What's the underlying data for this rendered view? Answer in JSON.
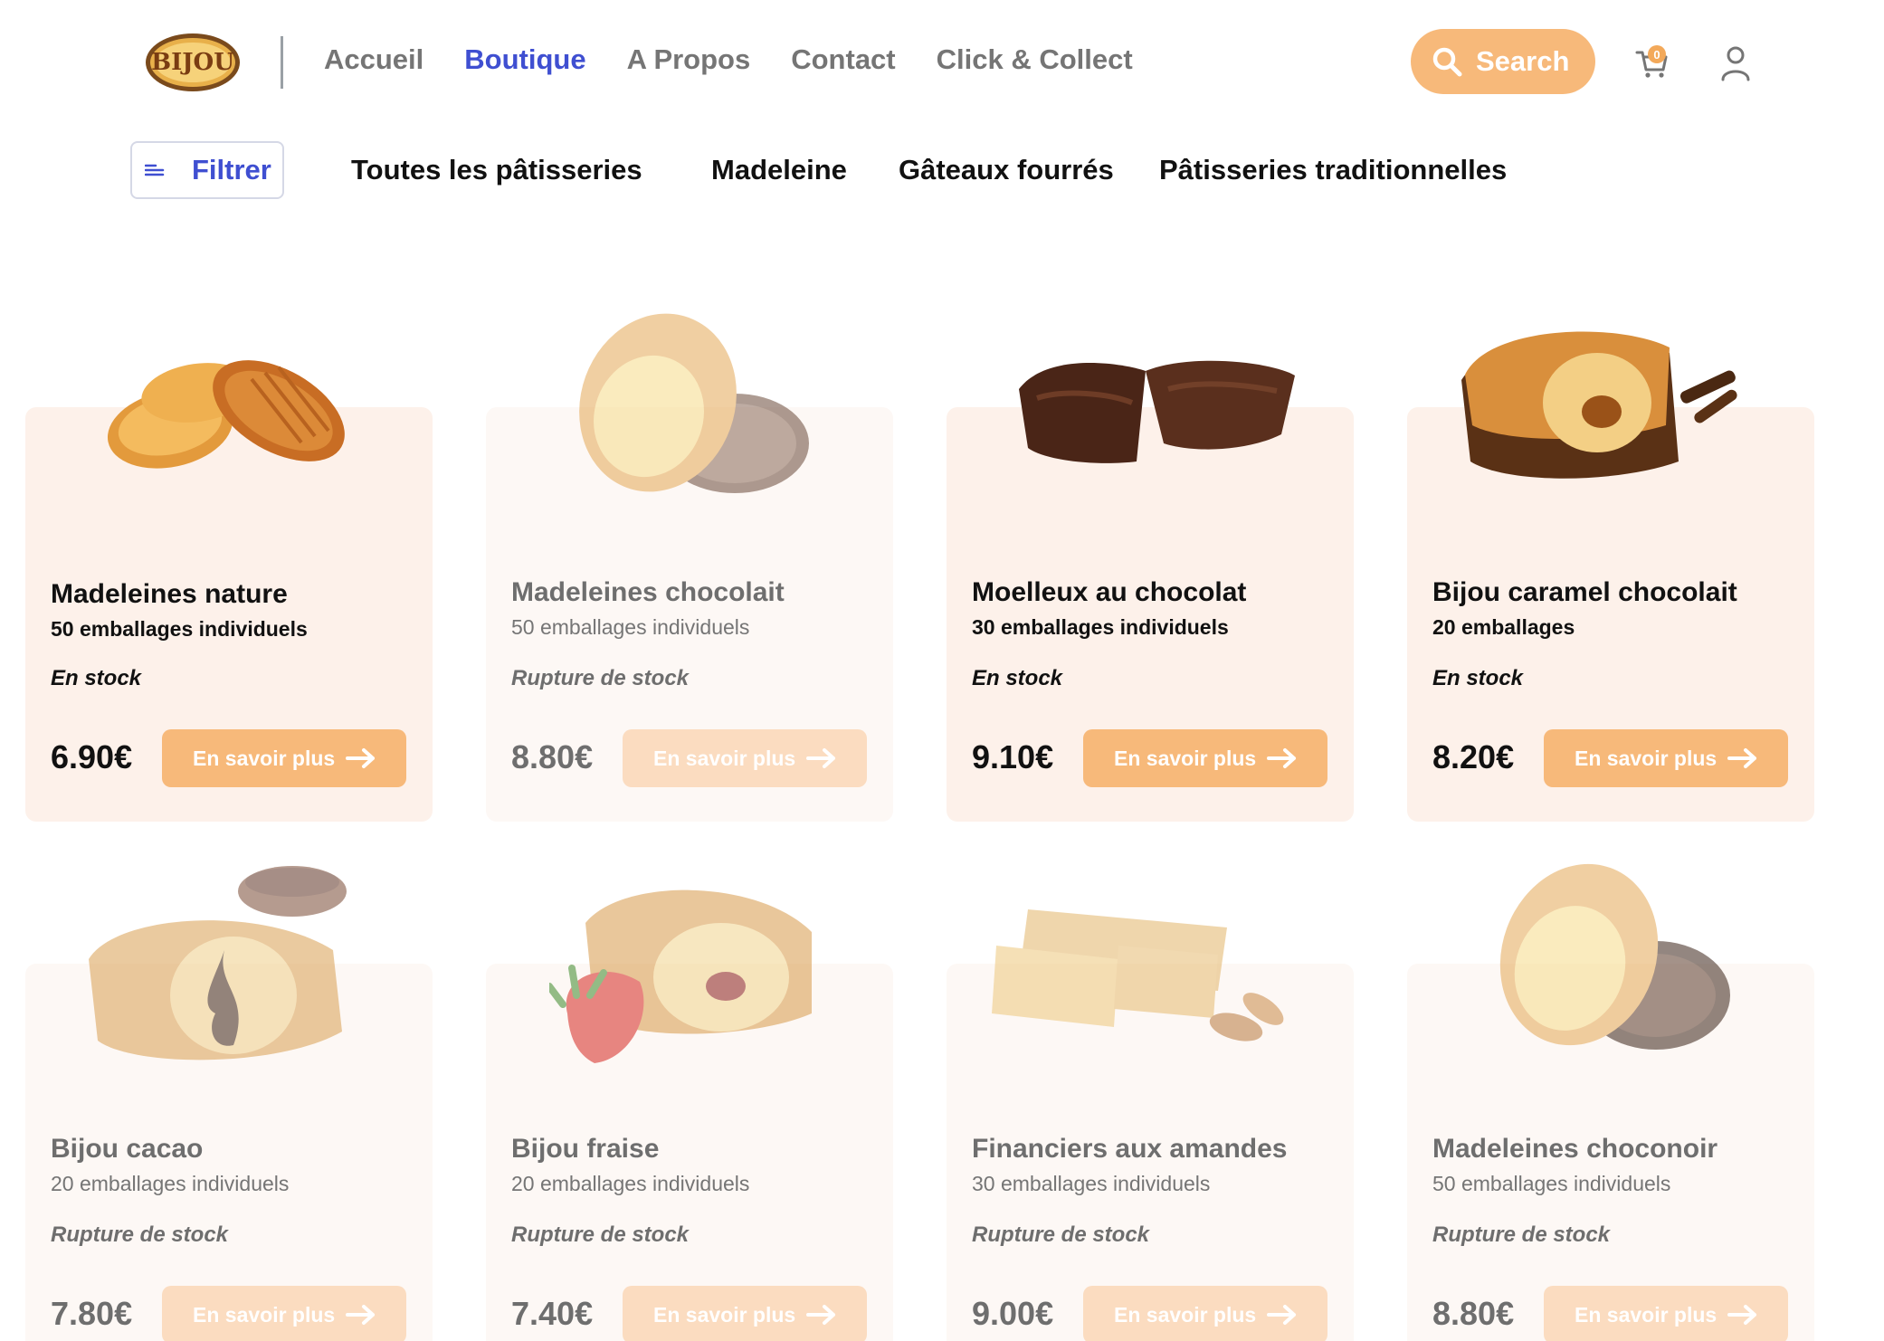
{
  "header": {
    "logo_text": "Bijou",
    "nav": [
      {
        "label": "Accueil",
        "active": false
      },
      {
        "label": "Boutique",
        "active": true
      },
      {
        "label": "A Propos",
        "active": false
      },
      {
        "label": "Contact",
        "active": false
      },
      {
        "label": "Click & Collect",
        "active": false
      }
    ],
    "search_label": "Search",
    "cart_count": "0",
    "icons": {
      "search": "search-icon",
      "cart": "cart-icon",
      "user": "user-icon"
    }
  },
  "categories": {
    "filter_label": "Filtrer",
    "items": [
      "Toutes les pâtisseries",
      "Madeleine",
      "Gâteaux fourrés",
      "Pâtisseries traditionnelles"
    ]
  },
  "colors": {
    "accent": "#f7b97a",
    "active_link": "#3f4fd1",
    "card_bg": "#fdf1ea"
  },
  "products": [
    {
      "name": "Madeleines nature",
      "pack": "50 emballages individuels",
      "stock": "En stock",
      "price": "6.90€",
      "cta": "En savoir plus",
      "available": true
    },
    {
      "name": "Madeleines chocolait",
      "pack": "50 emballages individuels",
      "stock": "Rupture de stock",
      "price": "8.80€",
      "cta": "En savoir plus",
      "available": false
    },
    {
      "name": "Moelleux au chocolat",
      "pack": "30 emballages individuels",
      "stock": "En stock",
      "price": "9.10€",
      "cta": "En savoir plus",
      "available": true
    },
    {
      "name": "Bijou caramel chocolait",
      "pack": "20 emballages",
      "stock": "En stock",
      "price": "8.20€",
      "cta": "En savoir plus",
      "available": true
    },
    {
      "name": "Bijou cacao",
      "pack": "20 emballages individuels",
      "stock": "Rupture de stock",
      "price": "7.80€",
      "cta": "En savoir plus",
      "available": false
    },
    {
      "name": "Bijou fraise",
      "pack": "20 emballages individuels",
      "stock": "Rupture de stock",
      "price": "7.40€",
      "cta": "En savoir plus",
      "available": false
    },
    {
      "name": "Financiers aux amandes",
      "pack": "30 emballages individuels",
      "stock": "Rupture de stock",
      "price": "9.00€",
      "cta": "En savoir plus",
      "available": false
    },
    {
      "name": "Madeleines choconoir",
      "pack": "50 emballages individuels",
      "stock": "Rupture de stock",
      "price": "8.80€",
      "cta": "En savoir plus",
      "available": false
    }
  ]
}
